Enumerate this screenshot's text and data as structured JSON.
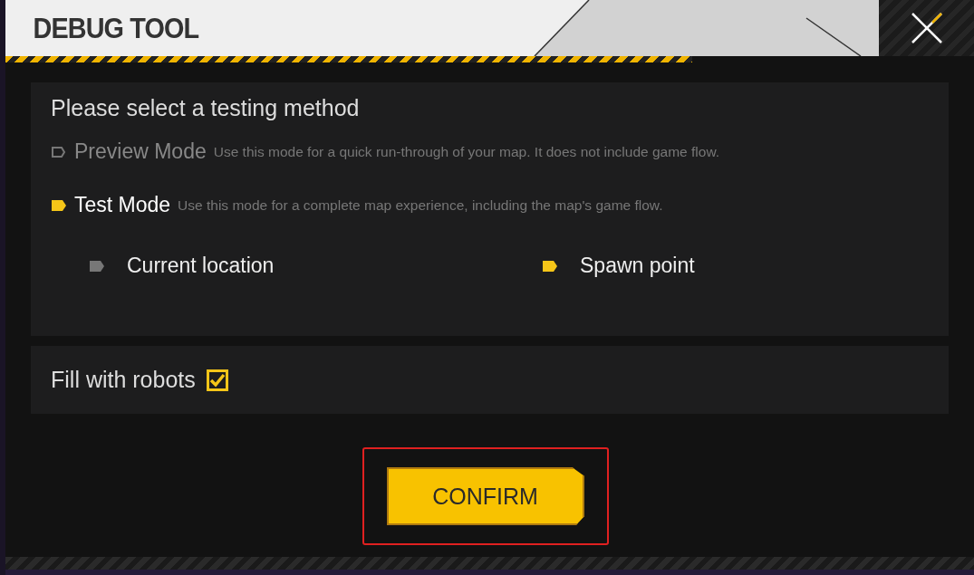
{
  "window": {
    "title": "DEBUG TOOL"
  },
  "method_section": {
    "heading": "Please select a testing method",
    "modes": [
      {
        "label": "Preview Mode",
        "description": "Use this mode for a quick run-through of your map. It does not include game flow.",
        "selected": false
      },
      {
        "label": "Test Mode",
        "description": "Use this mode for a complete map experience, including the map's game flow.",
        "selected": true
      }
    ],
    "start_positions": [
      {
        "label": "Current location",
        "selected": false
      },
      {
        "label": "Spawn point",
        "selected": true
      }
    ]
  },
  "robots": {
    "label": "Fill with robots",
    "checked": true
  },
  "buttons": [
    "CONFIRM"
  ]
}
